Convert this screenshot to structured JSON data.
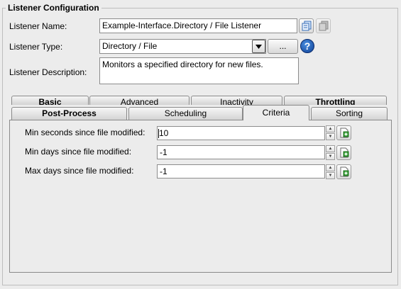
{
  "group": {
    "title": "Listener Configuration"
  },
  "name": {
    "label": "Listener Name:",
    "value": "Example-Interface.Directory / File Listener"
  },
  "type": {
    "label": "Listener Type:",
    "value": "Directory / File",
    "browse_label": "...",
    "help_label": "?"
  },
  "description": {
    "label": "Listener Description:",
    "value": "Monitors a specified directory for new files."
  },
  "tabs_row1": [
    "Basic",
    "Advanced",
    "Inactivity",
    "Throttling"
  ],
  "tabs_row2": [
    "Post-Process",
    "Scheduling",
    "Criteria",
    "Sorting"
  ],
  "active_tab": "Criteria",
  "criteria": [
    {
      "label": "Min seconds since file modified:",
      "value": "10"
    },
    {
      "label": "Min days since file modified:",
      "value": "-1"
    },
    {
      "label": "Max days since file modified:",
      "value": "-1"
    }
  ],
  "icons": {
    "copy": "copy-icon",
    "paste": "paste-icon",
    "add": "add-icon",
    "help": "help-icon"
  },
  "colors": {
    "help": "#1a56b8",
    "add_green": "#2e9b2e"
  }
}
